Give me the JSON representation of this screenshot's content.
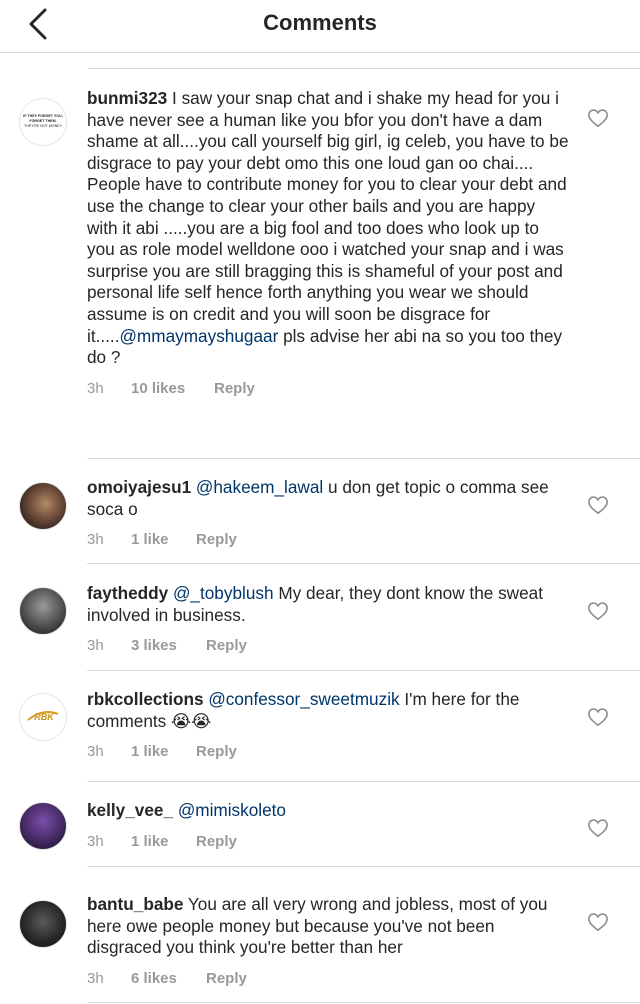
{
  "header": {
    "title": "Comments"
  },
  "comments": [
    {
      "username": "bunmi323",
      "segments": [
        {
          "t": "I saw your snap chat and i shake my head for you i have never see a human like you bfor you don't have a dam shame at all....you call yourself big girl, ig celeb, you have to be disgrace to pay your debt omo this one loud gan oo chai.... People have to contribute money for you to clear your debt and use the change to clear your other bails and you are happy with it abi .....you are a big fool and too does who look up to you as role model welldone ooo i watched your snap and i was surprise you are still bragging this is shameful of your post and personal life self hence forth anything you wear we should assume is on credit and you will soon be disgrace for it.....",
          "mention": false
        },
        {
          "t": "@mmaymayshugaar",
          "mention": true
        },
        {
          "t": " pls advise her abi na so you too they do ?",
          "mention": false
        }
      ],
      "time": "3h",
      "likes": "10 likes",
      "reply": "Reply",
      "avatar_text": [
        "IF THEY FORGET YOU,",
        "FORGET THEM.",
        "THEY'RE NOT MONEY"
      ]
    },
    {
      "username": "omoiyajesu1",
      "segments": [
        {
          "t": "@hakeem_lawal",
          "mention": true
        },
        {
          "t": " u don get topic o comma see soca o",
          "mention": false
        }
      ],
      "time": "3h",
      "likes": "1 like",
      "reply": "Reply"
    },
    {
      "username": "faytheddy",
      "segments": [
        {
          "t": "@_tobyblush",
          "mention": true
        },
        {
          "t": " My dear, they dont know the sweat involved in business.",
          "mention": false
        }
      ],
      "time": "3h",
      "likes": "3 likes",
      "reply": "Reply"
    },
    {
      "username": "rbkcollections",
      "segments": [
        {
          "t": "@confessor_sweetmuzik",
          "mention": true
        },
        {
          "t": " I'm here for the comments 😭😭",
          "mention": false
        }
      ],
      "time": "3h",
      "likes": "1 like",
      "reply": "Reply",
      "avatar_text": [
        "RBK"
      ]
    },
    {
      "username": "kelly_vee_",
      "segments": [
        {
          "t": "@mimiskoleto",
          "mention": true
        }
      ],
      "time": "3h",
      "likes": "1 like",
      "reply": "Reply"
    },
    {
      "username": "bantu_babe",
      "segments": [
        {
          "t": "You are all very wrong and jobless, most of you here owe people money but because you've not been disgraced you think you're better than her",
          "mention": false
        }
      ],
      "time": "3h",
      "likes": "6 likes",
      "reply": "Reply"
    }
  ],
  "colors": {
    "mention": "#003569",
    "meta": "#999999",
    "text": "#262626",
    "separator": "#dbdbdb"
  }
}
